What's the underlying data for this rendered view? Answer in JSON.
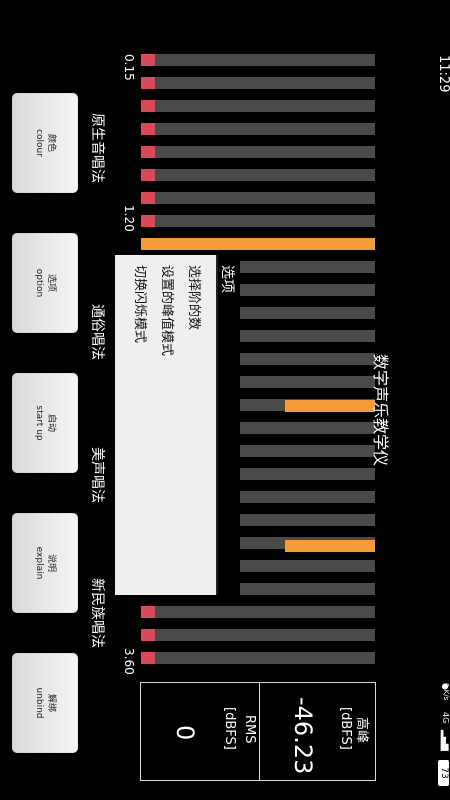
{
  "status_bar": {
    "time": "11:29",
    "battery": "73",
    "network": "4G",
    "speed": "0 K/s"
  },
  "app_title": "数字声乐教学仪",
  "scale": {
    "top_value": "0.15",
    "mid_value": "1.20",
    "bottom_value": "3.60"
  },
  "singing_styles": [
    "原生音唱法",
    "通俗唱法",
    "美声唱法",
    "新民族唱法"
  ],
  "buttons": [
    {
      "zh": "颜色",
      "en": "colour"
    },
    {
      "zh": "选项",
      "en": "option"
    },
    {
      "zh": "启动",
      "en": "start up"
    },
    {
      "zh": "说明",
      "en": "explain"
    },
    {
      "zh": "解绑",
      "en": "unbind"
    }
  ],
  "options_menu": {
    "title": "选项",
    "items": [
      "选择阶的数",
      "设置的峰值模式",
      "切换闪烁模式"
    ]
  },
  "readouts": {
    "peak": {
      "label": "高峰",
      "unit": "[dBFS]",
      "value": "-46.23"
    },
    "rms": {
      "label": "RMS",
      "unit": "[dBFS]",
      "value": "0"
    }
  },
  "colors": {
    "red": "#d9485b",
    "orange": "#f49a39",
    "track": "#4a4a4a"
  }
}
